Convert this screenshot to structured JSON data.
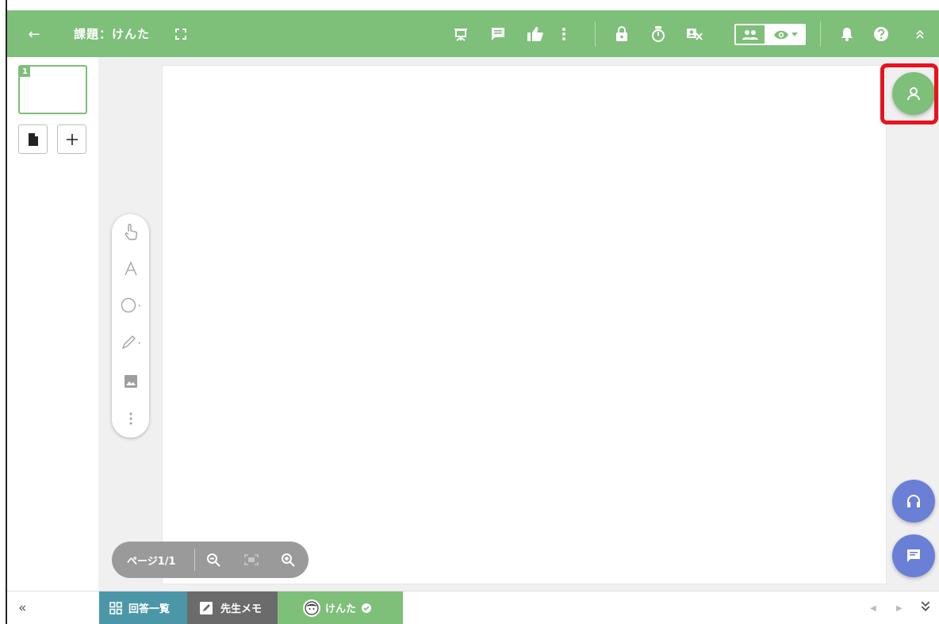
{
  "header": {
    "back_label": "←",
    "title": "課題：けんた"
  },
  "pages_panel": {
    "thumbnail_number": "1"
  },
  "zoom": {
    "page_indicator": "ページ1/1"
  },
  "bottom_tabs": {
    "answers_label": "回答一覧",
    "memo_label": "先生メモ",
    "student_label": "けんた"
  },
  "bottom_nav": {
    "collapse_label": "«"
  },
  "colors": {
    "header_green": "#7ebf7a",
    "teal_tab": "#4b97a8",
    "gray_tab": "#6b6b6b",
    "fab_blue": "#6a7fd6",
    "highlight_red": "#e8131e"
  },
  "icons": [
    "back-arrow-icon",
    "fullscreen-icon",
    "presentation-icon",
    "comment-icon",
    "thumbs-up-icon",
    "more-vert-icon",
    "lock-icon",
    "timer-icon",
    "hide-names-icon",
    "group-view-icon",
    "eye-icon",
    "bell-icon",
    "help-icon",
    "chevron-up-double-icon",
    "file-icon",
    "plus-icon",
    "hand-pointer-icon",
    "text-icon",
    "circle-shape-icon",
    "pencil-icon",
    "image-icon",
    "more-icon",
    "zoom-out-icon",
    "fit-screen-icon",
    "zoom-in-icon",
    "user-switch-icon",
    "headset-icon",
    "chat-icon",
    "grid-icon",
    "edit-note-icon",
    "student-avatar-icon",
    "verified-icon",
    "chevron-down-double-icon"
  ]
}
